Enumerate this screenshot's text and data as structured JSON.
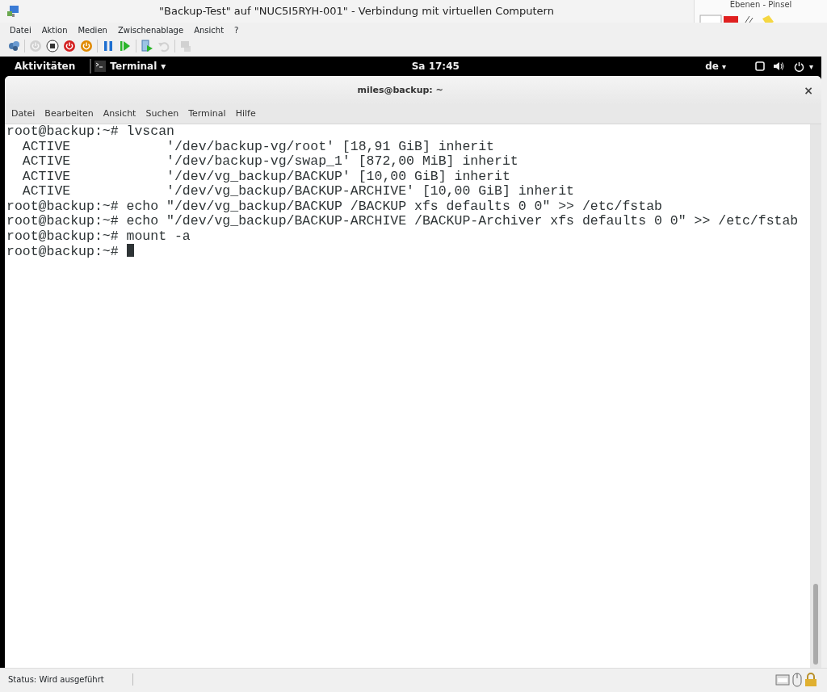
{
  "window": {
    "title": "\"Backup-Test\" auf \"NUC5I5RYH-001\" - Verbindung mit virtuellen Computern"
  },
  "side_app": {
    "title": "Ebenen - Pinsel"
  },
  "menu": [
    "Datei",
    "Aktion",
    "Medien",
    "Zwischenablage",
    "Ansicht",
    "?"
  ],
  "toolbar": [
    {
      "kind": "keys",
      "disabled": false
    },
    {
      "kind": "sep"
    },
    {
      "kind": "start",
      "disabled": true
    },
    {
      "kind": "stop",
      "disabled": false
    },
    {
      "kind": "shutdown",
      "disabled": false
    },
    {
      "kind": "save",
      "disabled": false
    },
    {
      "kind": "sep"
    },
    {
      "kind": "pause",
      "disabled": false
    },
    {
      "kind": "reset",
      "disabled": false
    },
    {
      "kind": "sep"
    },
    {
      "kind": "checkpoint",
      "disabled": false
    },
    {
      "kind": "revert",
      "disabled": true
    },
    {
      "kind": "sep"
    },
    {
      "kind": "session",
      "disabled": true
    }
  ],
  "gnome": {
    "activities": "Aktivitäten",
    "app": "Terminal",
    "app_caret": "▾",
    "clock": "Sa 17:45",
    "keyboard": "de",
    "keyboard_caret": "▾",
    "system_caret": "▾"
  },
  "terminal": {
    "title": "miles@backup: ~",
    "close": "×",
    "menu": [
      "Datei",
      "Bearbeiten",
      "Ansicht",
      "Suchen",
      "Terminal",
      "Hilfe"
    ],
    "lines": [
      "root@backup:~# lvscan",
      "  ACTIVE            '/dev/backup-vg/root' [18,91 GiB] inherit",
      "  ACTIVE            '/dev/backup-vg/swap_1' [872,00 MiB] inherit",
      "  ACTIVE            '/dev/vg_backup/BACKUP' [10,00 GiB] inherit",
      "  ACTIVE            '/dev/vg_backup/BACKUP-ARCHIVE' [10,00 GiB] inherit",
      "root@backup:~# echo \"/dev/vg_backup/BACKUP /BACKUP xfs defaults 0 0\" >> /etc/fstab",
      "root@backup:~# echo \"/dev/vg_backup/BACKUP-ARCHIVE /BACKUP-Archiver xfs defaults 0 0\" >> /etc/fstab",
      "root@backup:~# mount -a",
      "root@backup:~# "
    ],
    "cursor": true
  },
  "status_bar": {
    "text": "Status: Wird ausgeführt"
  }
}
